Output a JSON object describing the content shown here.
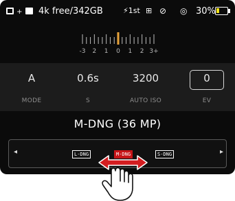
{
  "status_bar": {
    "storage_text": "4k free/342GB",
    "flash_text": "⚡1st",
    "battery_text": "30%",
    "battery_level": 0.3,
    "battery_color": "#f2e21a",
    "icons": [
      "sd-card-icon",
      "internal-memory-icon",
      "flash-icon",
      "white-balance-icon",
      "no-flash-icon",
      "self-timer-icon",
      "battery-icon"
    ]
  },
  "exposure_scale": {
    "labels": [
      "-3",
      "2",
      "1",
      "0",
      "1",
      "2",
      "3+"
    ],
    "current_value": 0,
    "marker_color": "#e8a33a"
  },
  "settings": {
    "mode": {
      "value": "A",
      "label": "MODE"
    },
    "shutter": {
      "value": "0.6s",
      "label": "S"
    },
    "iso": {
      "value": "3200",
      "label": "AUTO ISO"
    },
    "ev": {
      "value": "0",
      "label": "EV"
    }
  },
  "file_format": {
    "title": "M-DNG (36 MP)",
    "options": [
      "L-DNG",
      "M-DNG",
      "S-DNG"
    ],
    "selected": "M-DNG",
    "active_color": "#c71518"
  },
  "gesture": {
    "icons": [
      "swipe-hand-icon",
      "double-arrow-icon"
    ],
    "arrow_color": "#d41d20"
  }
}
